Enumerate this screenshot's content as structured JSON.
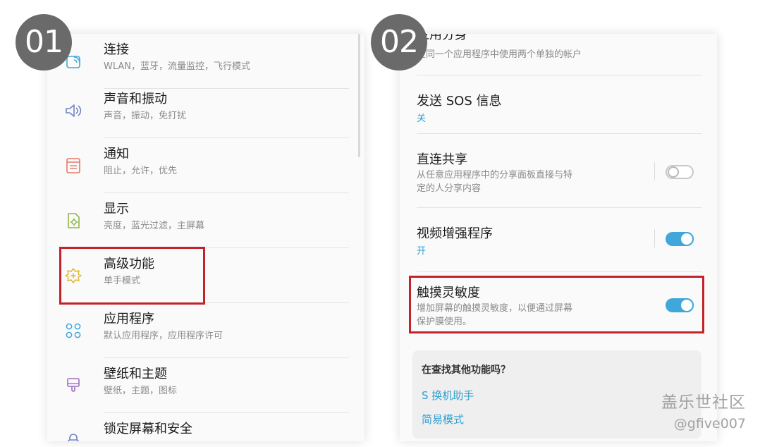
{
  "steps": {
    "step1": "01",
    "step2": "02"
  },
  "settings": [
    {
      "title": "连接",
      "subtitle": "WLAN，蓝牙，流量监控，飞行模式",
      "icon": "connection-icon"
    },
    {
      "title": "声音和振动",
      "subtitle": "声音，振动，免打扰",
      "icon": "speaker-icon"
    },
    {
      "title": "通知",
      "subtitle": "阻止，允许，优先",
      "icon": "notification-icon"
    },
    {
      "title": "显示",
      "subtitle": "亮度，蓝光过滤，主屏幕",
      "icon": "display-icon"
    },
    {
      "title": "高级功能",
      "subtitle": "单手模式",
      "icon": "advanced-features-icon"
    },
    {
      "title": "应用程序",
      "subtitle": "默认应用程序，应用程序许可",
      "icon": "apps-icon"
    },
    {
      "title": "壁纸和主题",
      "subtitle": "壁纸，主题，图标",
      "icon": "brush-icon"
    },
    {
      "title": "锁定屏幕和安全",
      "subtitle": "",
      "icon": "lock-icon"
    }
  ],
  "advanced": {
    "dual_account_title": "应用分身",
    "dual_account_subtitle": "在同一个应用程序中使用两个单独的帐户",
    "sos": {
      "title": "发送 SOS 信息",
      "status": "关"
    },
    "direct_share": {
      "title": "直连共享",
      "line1": "从任意应用程序中的分享面板直接与特",
      "line2": "定的人分享内容",
      "enabled": false
    },
    "video_enhancer": {
      "title": "视频增强程序",
      "status": "开",
      "enabled": true
    },
    "touch_sensitivity": {
      "title": "触摸灵敏度",
      "line1": "增加屏幕的触摸灵敏度，以便通过屏幕",
      "line2": "保护膜使用。",
      "enabled": true
    },
    "suggestions": {
      "question": "在查找其他功能吗？",
      "links": [
        "S 换机助手",
        "简易模式"
      ]
    }
  },
  "colors": {
    "highlight": "#c4222a",
    "accent": "#3fa7da",
    "link": "#2e9fd0",
    "badge": "#6a6a6a"
  },
  "watermark": {
    "line1": "盖乐世社区",
    "line2": "@gfive007"
  }
}
